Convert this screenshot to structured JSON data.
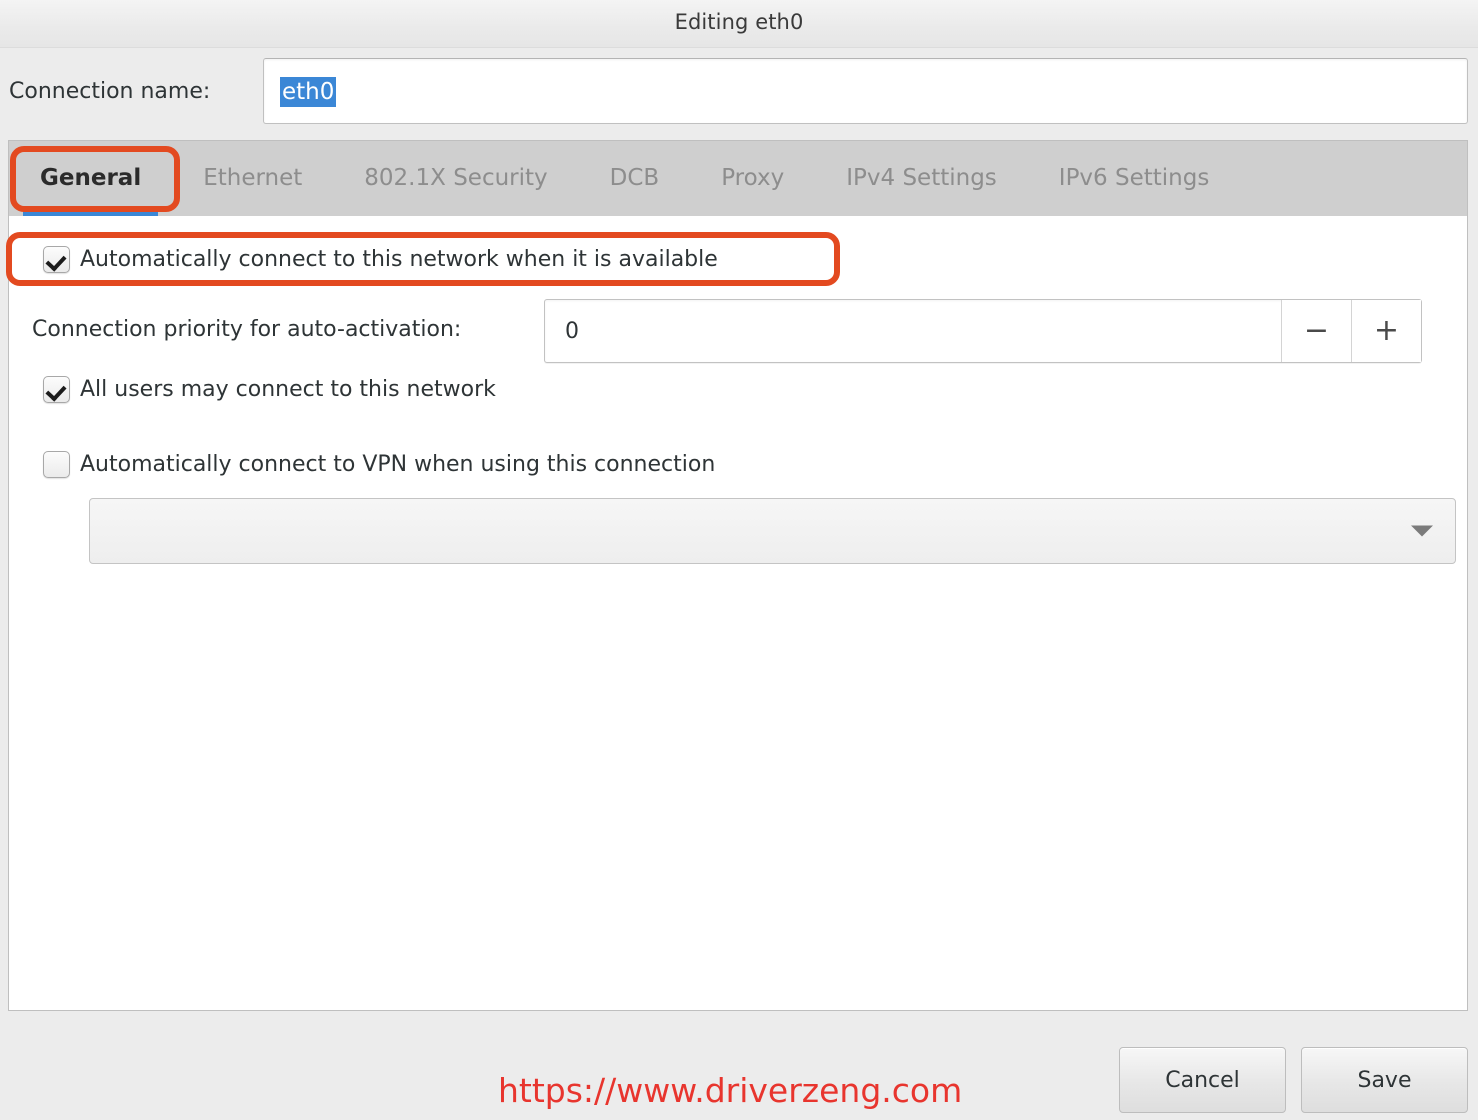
{
  "window": {
    "title": "Editing eth0"
  },
  "connection_name": {
    "label": "Connection name:",
    "value": "eth0",
    "selected": true
  },
  "tabs": [
    {
      "label": "General",
      "active": true
    },
    {
      "label": "Ethernet",
      "active": false
    },
    {
      "label": "802.1X Security",
      "active": false
    },
    {
      "label": "DCB",
      "active": false
    },
    {
      "label": "Proxy",
      "active": false
    },
    {
      "label": "IPv4 Settings",
      "active": false
    },
    {
      "label": "IPv6 Settings",
      "active": false
    }
  ],
  "general": {
    "auto_connect": {
      "label": "Automatically connect to this network when it is available",
      "checked": true,
      "highlighted": true
    },
    "priority": {
      "label": "Connection priority for auto-activation:",
      "value": "0",
      "decrement_label": "−",
      "increment_label": "+"
    },
    "all_users": {
      "label": "All users may connect to this network",
      "checked": true
    },
    "vpn_auto": {
      "label": "Automatically connect to VPN when using this connection",
      "checked": false
    },
    "vpn_select": {
      "value": "",
      "arrow_icon": "chevron-down-icon"
    }
  },
  "footer": {
    "watermark": "https://www.driverzeng.com",
    "cancel_label": "Cancel",
    "save_label": "Save"
  },
  "colors": {
    "accent_blue": "#3b87d6",
    "highlight_orange": "#e34a20",
    "watermark_red": "#e8352e",
    "window_bg": "#ececec",
    "tab_bg": "#cfcfcf",
    "panel_bg": "#ffffff"
  }
}
